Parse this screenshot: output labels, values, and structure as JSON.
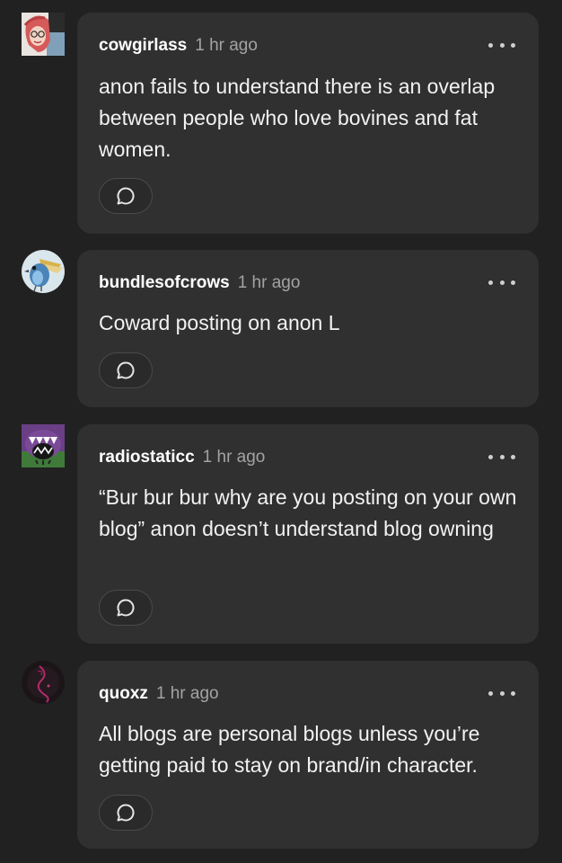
{
  "replies": [
    {
      "username": "cowgirlass",
      "time": "1 hr ago",
      "text": "anon fails to understand there is an overlap between people who love bovines and fat women.",
      "avatar_icon": "cowgirl-avatar-icon",
      "more_icon": "more-options-icon",
      "reply_icon": "speech-bubble-icon"
    },
    {
      "username": "bundlesofcrows",
      "time": "1 hr ago",
      "text": "Coward posting on anon L",
      "avatar_icon": "bird-avatar-icon",
      "more_icon": "more-options-icon",
      "reply_icon": "speech-bubble-icon"
    },
    {
      "username": "radiostaticc",
      "time": "1 hr ago",
      "text": "“Bur bur bur why are you posting on your own blog” anon doesn’t understand blog owning",
      "avatar_icon": "monster-avatar-icon",
      "more_icon": "more-options-icon",
      "reply_icon": "speech-bubble-icon"
    },
    {
      "username": "quoxz",
      "time": "1 hr ago",
      "text": "All blogs are personal blogs unless you’re getting paid to stay on brand/in character.",
      "avatar_icon": "dark-swirl-avatar-icon",
      "more_icon": "more-options-icon",
      "reply_icon": "speech-bubble-icon"
    }
  ],
  "colors": {
    "background": "#212121",
    "bubble": "#303030",
    "timestamp": "#a3a3a3",
    "text": "#f2f2f2"
  }
}
